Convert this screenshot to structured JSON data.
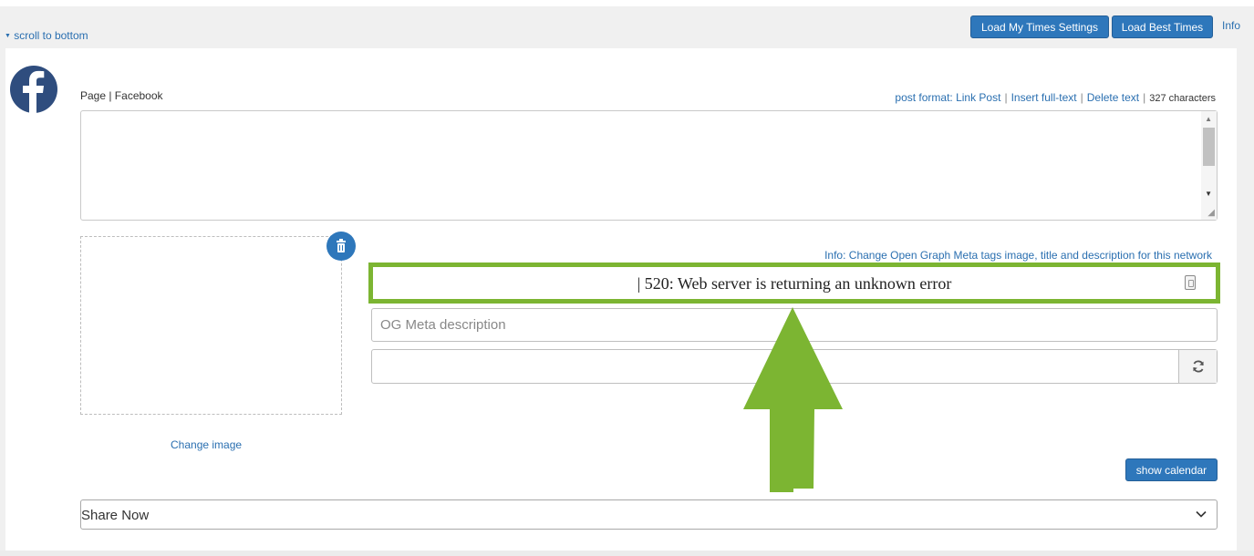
{
  "topbar": {
    "scroll_link": "scroll to bottom",
    "load_my_times": "Load My Times Settings",
    "load_best_times": "Load Best Times",
    "info": "Info"
  },
  "network": {
    "icon": "facebook-icon",
    "label": "Page | Facebook"
  },
  "actions": {
    "post_format": "post format: Link Post",
    "insert_full_text": "Insert full-text",
    "delete_text": "Delete text",
    "char_count": "327 characters",
    "separator": "|"
  },
  "message": {
    "value": ""
  },
  "image": {
    "change_label": "Change image",
    "delete_icon": "trash-icon"
  },
  "og": {
    "info": "Info: Change Open Graph Meta tags image, title and description for this network",
    "title_value": "| 520: Web server is returning an unknown error",
    "description_placeholder": "OG Meta description",
    "url_value": "",
    "refresh_icon": "refresh-icon"
  },
  "annotation": {
    "arrow_icon": "arrow-up-icon",
    "highlight_color": "#7cb532"
  },
  "calendar": {
    "show_label": "show calendar"
  },
  "share": {
    "selected": "Share Now"
  },
  "colors": {
    "accent": "#2e77bb",
    "link": "#2a6fb0",
    "highlight": "#7cb532"
  }
}
